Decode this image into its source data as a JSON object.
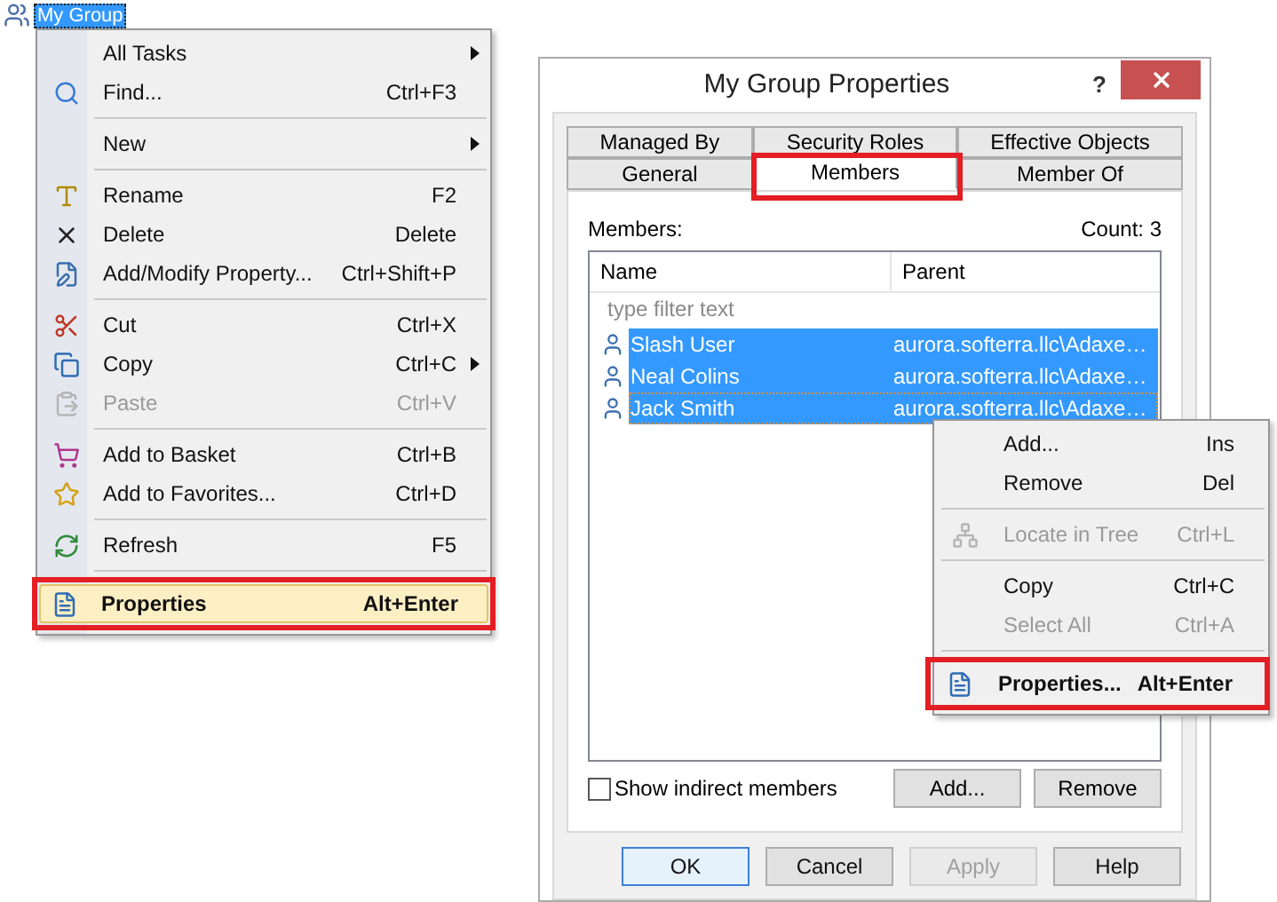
{
  "tree_item": {
    "label": "My Group",
    "selected": true
  },
  "context_menu": {
    "items": [
      {
        "kind": "item",
        "label": "All Tasks",
        "submenu": true
      },
      {
        "kind": "item",
        "label": "Find...",
        "shortcut": "Ctrl+F3"
      },
      {
        "kind": "separator"
      },
      {
        "kind": "item",
        "label": "New",
        "submenu": true
      },
      {
        "kind": "separator"
      },
      {
        "kind": "item",
        "label": "Rename",
        "shortcut": "F2"
      },
      {
        "kind": "item",
        "label": "Delete",
        "shortcut": "Delete"
      },
      {
        "kind": "item",
        "label": "Add/Modify Property...",
        "shortcut": "Ctrl+Shift+P"
      },
      {
        "kind": "separator"
      },
      {
        "kind": "item",
        "label": "Cut",
        "shortcut": "Ctrl+X"
      },
      {
        "kind": "item",
        "label": "Copy",
        "shortcut": "Ctrl+C",
        "submenu": true
      },
      {
        "kind": "item",
        "label": "Paste",
        "shortcut": "Ctrl+V",
        "disabled": true
      },
      {
        "kind": "separator"
      },
      {
        "kind": "item",
        "label": "Add to Basket",
        "shortcut": "Ctrl+B"
      },
      {
        "kind": "item",
        "label": "Add to Favorites...",
        "shortcut": "Ctrl+D"
      },
      {
        "kind": "separator"
      },
      {
        "kind": "item",
        "label": "Refresh",
        "shortcut": "F5"
      },
      {
        "kind": "separator"
      },
      {
        "kind": "item",
        "label": "Properties",
        "shortcut": "Alt+Enter",
        "default": true,
        "highlighted": true,
        "callout": true
      }
    ]
  },
  "dialog": {
    "title": "My Group Properties",
    "help": "?",
    "tab_rows": [
      {
        "tabs": [
          {
            "label": "Managed By",
            "selected": false
          },
          {
            "label": "Security Roles",
            "selected": false
          },
          {
            "label": "Effective Objects",
            "selected": false
          }
        ]
      },
      {
        "tabs": [
          {
            "label": "General",
            "selected": false
          },
          {
            "label": "Members",
            "selected": true,
            "callout": true
          },
          {
            "label": "Member Of",
            "selected": false
          }
        ]
      }
    ],
    "members_label": "Members:",
    "count": "Count: 3",
    "columns": [
      "Name",
      "Parent"
    ],
    "filter": {
      "placeholder": "type filter text"
    },
    "rows": [
      {
        "name": "Slash User",
        "parent": "aurora.softerra.llc\\Adaxe…",
        "selected": true,
        "focused": false
      },
      {
        "name": "Neal Colins",
        "parent": "aurora.softerra.llc\\Adaxe…",
        "selected": true,
        "focused": false
      },
      {
        "name": "Jack Smith",
        "parent": "aurora.softerra.llc\\Adaxe…",
        "selected": true,
        "focused": true
      }
    ],
    "show_indirect": {
      "label": "Show indirect members",
      "checked": false
    },
    "list_buttons": [
      "Add...",
      "Remove"
    ],
    "footer_buttons": [
      {
        "label": "OK",
        "default": true,
        "disabled": false
      },
      {
        "label": "Cancel",
        "default": false,
        "disabled": false
      },
      {
        "label": "Apply",
        "default": false,
        "disabled": true
      },
      {
        "label": "Help",
        "default": false,
        "disabled": false
      }
    ]
  },
  "list_menu": {
    "items": [
      {
        "kind": "item",
        "label": "Add...",
        "shortcut": "Ins"
      },
      {
        "kind": "item",
        "label": "Remove",
        "shortcut": "Del"
      },
      {
        "kind": "separator"
      },
      {
        "kind": "item",
        "label": "Locate in Tree",
        "shortcut": "Ctrl+L",
        "disabled": true
      },
      {
        "kind": "separator"
      },
      {
        "kind": "item",
        "label": "Copy",
        "shortcut": "Ctrl+C"
      },
      {
        "kind": "item",
        "label": "Select All",
        "shortcut": "Ctrl+A",
        "disabled": true
      },
      {
        "kind": "separator"
      },
      {
        "kind": "item",
        "label": "Properties...",
        "shortcut": "Alt+Enter",
        "default": true,
        "highlighted": false,
        "callout": true
      }
    ]
  }
}
